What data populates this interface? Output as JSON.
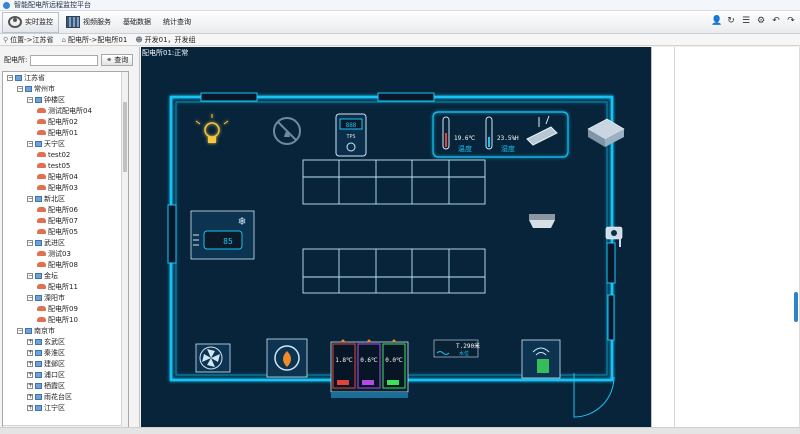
{
  "window": {
    "title": "智能配电所远程监控平台"
  },
  "toolbar": {
    "items": [
      {
        "label": "实时监控",
        "icon": "eye-icon",
        "active": true
      },
      {
        "label": "视频服务",
        "icon": "film-icon",
        "active": false
      },
      {
        "label": "基础数据",
        "icon": "",
        "active": false
      },
      {
        "label": "统计查询",
        "icon": "",
        "active": false
      }
    ],
    "right_icons": [
      "user-icon",
      "refresh-icon",
      "list-icon",
      "settings-icon",
      "undo-icon",
      "redo-icon"
    ]
  },
  "breadcrumb": {
    "items": [
      {
        "label": "位置->江苏省",
        "icon": "location-icon"
      },
      {
        "label": "配电所->配电所01",
        "icon": "home-icon"
      },
      {
        "label": "开发01，开发组",
        "icon": "user-icon"
      }
    ]
  },
  "search": {
    "label": "配电所:",
    "value": "",
    "button_label": "查询"
  },
  "tree": [
    {
      "label": "江苏省",
      "level": 0,
      "type": "folder",
      "expanded": true
    },
    {
      "label": "常州市",
      "level": 1,
      "type": "folder",
      "expanded": true
    },
    {
      "label": "钟楼区",
      "level": 2,
      "type": "folder",
      "expanded": true
    },
    {
      "label": "测试配电所04",
      "level": 3,
      "type": "leaf"
    },
    {
      "label": "配电所02",
      "level": 3,
      "type": "leaf"
    },
    {
      "label": "配电所01",
      "level": 3,
      "type": "leaf"
    },
    {
      "label": "天宁区",
      "level": 2,
      "type": "folder",
      "expanded": true
    },
    {
      "label": "test02",
      "level": 3,
      "type": "leaf"
    },
    {
      "label": "test05",
      "level": 3,
      "type": "leaf"
    },
    {
      "label": "配电所04",
      "level": 3,
      "type": "leaf"
    },
    {
      "label": "配电所03",
      "level": 3,
      "type": "leaf"
    },
    {
      "label": "新北区",
      "level": 2,
      "type": "folder",
      "expanded": true
    },
    {
      "label": "配电所06",
      "level": 3,
      "type": "leaf"
    },
    {
      "label": "配电所07",
      "level": 3,
      "type": "leaf"
    },
    {
      "label": "配电所05",
      "level": 3,
      "type": "leaf"
    },
    {
      "label": "武进区",
      "level": 2,
      "type": "folder",
      "expanded": true
    },
    {
      "label": "测试03",
      "level": 3,
      "type": "leaf"
    },
    {
      "label": "配电所08",
      "level": 3,
      "type": "leaf"
    },
    {
      "label": "金坛",
      "level": 2,
      "type": "folder",
      "expanded": true
    },
    {
      "label": "配电所11",
      "level": 3,
      "type": "leaf"
    },
    {
      "label": "溧阳市",
      "level": 2,
      "type": "folder",
      "expanded": true
    },
    {
      "label": "配电所09",
      "level": 3,
      "type": "leaf"
    },
    {
      "label": "配电所10",
      "level": 3,
      "type": "leaf"
    },
    {
      "label": "南京市",
      "level": 1,
      "type": "folder",
      "expanded": true
    },
    {
      "label": "玄武区",
      "level": 2,
      "type": "folder",
      "expanded": false
    },
    {
      "label": "秦淮区",
      "level": 2,
      "type": "folder",
      "expanded": false
    },
    {
      "label": "建邺区",
      "level": 2,
      "type": "folder",
      "expanded": false
    },
    {
      "label": "浦口区",
      "level": 2,
      "type": "folder",
      "expanded": false
    },
    {
      "label": "栖霞区",
      "level": 2,
      "type": "folder",
      "expanded": false
    },
    {
      "label": "雨花台区",
      "level": 2,
      "type": "folder",
      "expanded": false
    },
    {
      "label": "江宁区",
      "level": 2,
      "type": "folder",
      "expanded": false
    }
  ],
  "monitor": {
    "status_label": "配电所01:正常",
    "sensors": {
      "temperature": "19.6℃",
      "humidity": "23.5%H",
      "temperature_label": "温度",
      "humidity_label": "湿度",
      "display_mini": "TPS",
      "ac_display": "85",
      "water_level": "T.290米",
      "water_label": "水位"
    },
    "cabinet_temps": [
      "1.8℃",
      "0.6℃",
      "0.0℃"
    ],
    "colors": {
      "accent": "#19c3f5",
      "bg": "#07243a",
      "cab_red": "#e0433a",
      "cab_purple": "#b04ce0",
      "cab_green": "#3ee05a"
    }
  }
}
